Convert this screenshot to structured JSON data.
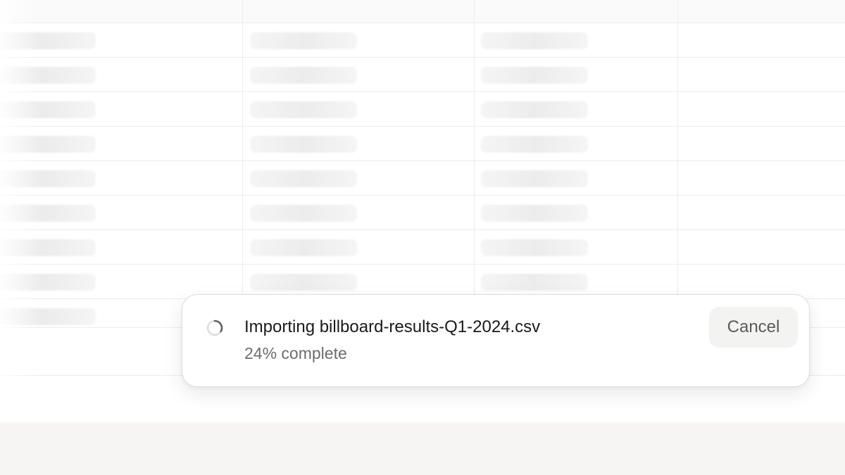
{
  "import_toast": {
    "status_icon": "loading-spinner-icon",
    "title": "Importing billboard-results-Q1-2024.csv",
    "progress_text": "24% complete",
    "progress_percent": 24,
    "cancel_label": "Cancel"
  },
  "background_table": {
    "state": "loading-skeleton",
    "columns": 4
  },
  "colors": {
    "page_background": "#f6f5f3",
    "toast_background": "#ffffff",
    "cancel_button_background": "#f3f3f2",
    "spinner_track": "#dedede",
    "spinner_arc": "#616161"
  }
}
